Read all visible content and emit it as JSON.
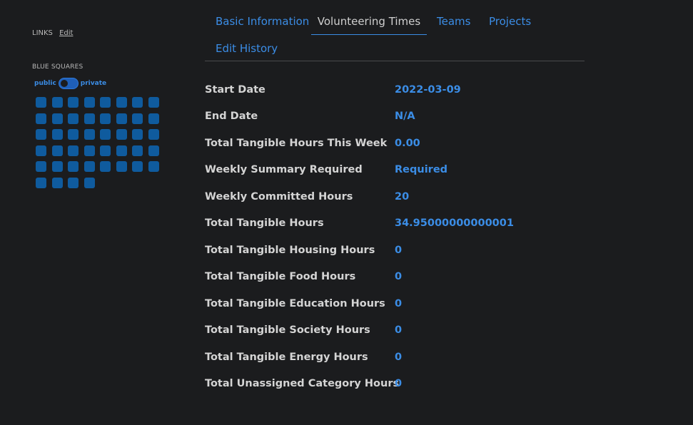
{
  "sidebar": {
    "links_label": "LINKS",
    "links_edit": "Edit",
    "blue_squares_label": "BLUE SQUARES",
    "toggle_public": "public",
    "toggle_private": "private",
    "blue_squares_count": 44
  },
  "tabs": [
    {
      "label": "Basic Information",
      "active": false
    },
    {
      "label": "Volunteering Times",
      "active": true
    },
    {
      "label": "Teams",
      "active": false
    },
    {
      "label": "Projects",
      "active": false
    },
    {
      "label": "Edit History",
      "active": false
    }
  ],
  "info_rows": [
    {
      "label": "Start Date",
      "value": "2022-03-09"
    },
    {
      "label": "End Date",
      "value": "N/A"
    },
    {
      "label": "Total Tangible Hours This Week",
      "value": "0.00"
    },
    {
      "label": "Weekly Summary Required",
      "value": "Required"
    },
    {
      "label": "Weekly Committed Hours",
      "value": "20"
    },
    {
      "label": "Total Tangible Hours",
      "value": "34.95000000000001"
    },
    {
      "label": "Total Tangible Housing Hours",
      "value": "0"
    },
    {
      "label": "Total Tangible Food Hours",
      "value": "0"
    },
    {
      "label": "Total Tangible Education Hours",
      "value": "0"
    },
    {
      "label": "Total Tangible Society Hours",
      "value": "0"
    },
    {
      "label": "Total Tangible Energy Hours",
      "value": "0"
    },
    {
      "label": "Total Unassigned Category Hours",
      "value": "0"
    }
  ],
  "colors": {
    "background": "#1b1c1e",
    "accent": "#3b8de6",
    "square": "#0f5b9e"
  }
}
